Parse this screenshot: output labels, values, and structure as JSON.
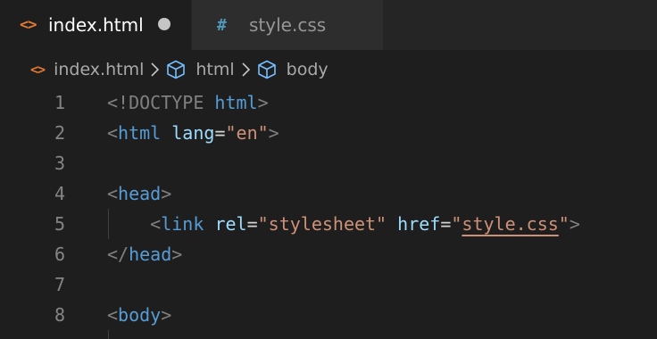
{
  "tabs": [
    {
      "icon": "<>",
      "label": "index.html",
      "state": "active, unsaved"
    },
    {
      "icon": "#",
      "label": "style.css",
      "state": "inactive"
    }
  ],
  "breadcrumb": {
    "file": "index.html",
    "items": [
      "html",
      "body"
    ]
  },
  "colors": {
    "html_icon": "#e37933",
    "css_icon": "#519aba",
    "tag": "#569cd6",
    "attribute": "#9cdcfe",
    "string": "#ce9178",
    "punctuation": "#808080",
    "line_number": "#858585",
    "background": "#1e1e1e"
  },
  "editor": {
    "lines": [
      {
        "num": "1",
        "tokens": [
          [
            "punct",
            "<"
          ],
          [
            "punct",
            "!DOCTYPE"
          ],
          [
            "eq",
            " "
          ],
          [
            "tag",
            "html"
          ],
          [
            "punct",
            ">"
          ]
        ]
      },
      {
        "num": "2",
        "tokens": [
          [
            "punct",
            "<"
          ],
          [
            "tag",
            "html"
          ],
          [
            "eq",
            " "
          ],
          [
            "attr",
            "lang"
          ],
          [
            "eq",
            "="
          ],
          [
            "str",
            "\"en\""
          ],
          [
            "punct",
            ">"
          ]
        ]
      },
      {
        "num": "3",
        "tokens": []
      },
      {
        "num": "4",
        "tokens": [
          [
            "punct",
            "<"
          ],
          [
            "tag",
            "head"
          ],
          [
            "punct",
            ">"
          ]
        ]
      },
      {
        "num": "5",
        "tokens": [
          [
            "eq",
            "    "
          ],
          [
            "punct",
            "<"
          ],
          [
            "tag",
            "link"
          ],
          [
            "eq",
            " "
          ],
          [
            "attr",
            "rel"
          ],
          [
            "eq",
            "="
          ],
          [
            "str",
            "\"stylesheet\""
          ],
          [
            "eq",
            " "
          ],
          [
            "attr",
            "href"
          ],
          [
            "eq",
            "="
          ],
          [
            "str",
            "\""
          ],
          [
            "str warn",
            "style.css"
          ],
          [
            "str",
            "\""
          ],
          [
            "punct",
            ">"
          ]
        ]
      },
      {
        "num": "6",
        "tokens": [
          [
            "punct",
            "</"
          ],
          [
            "tag",
            "head"
          ],
          [
            "punct",
            ">"
          ]
        ]
      },
      {
        "num": "7",
        "tokens": []
      },
      {
        "num": "8",
        "tokens": [
          [
            "punct",
            "<"
          ],
          [
            "tag",
            "body"
          ],
          [
            "punct",
            ">"
          ]
        ]
      }
    ]
  }
}
